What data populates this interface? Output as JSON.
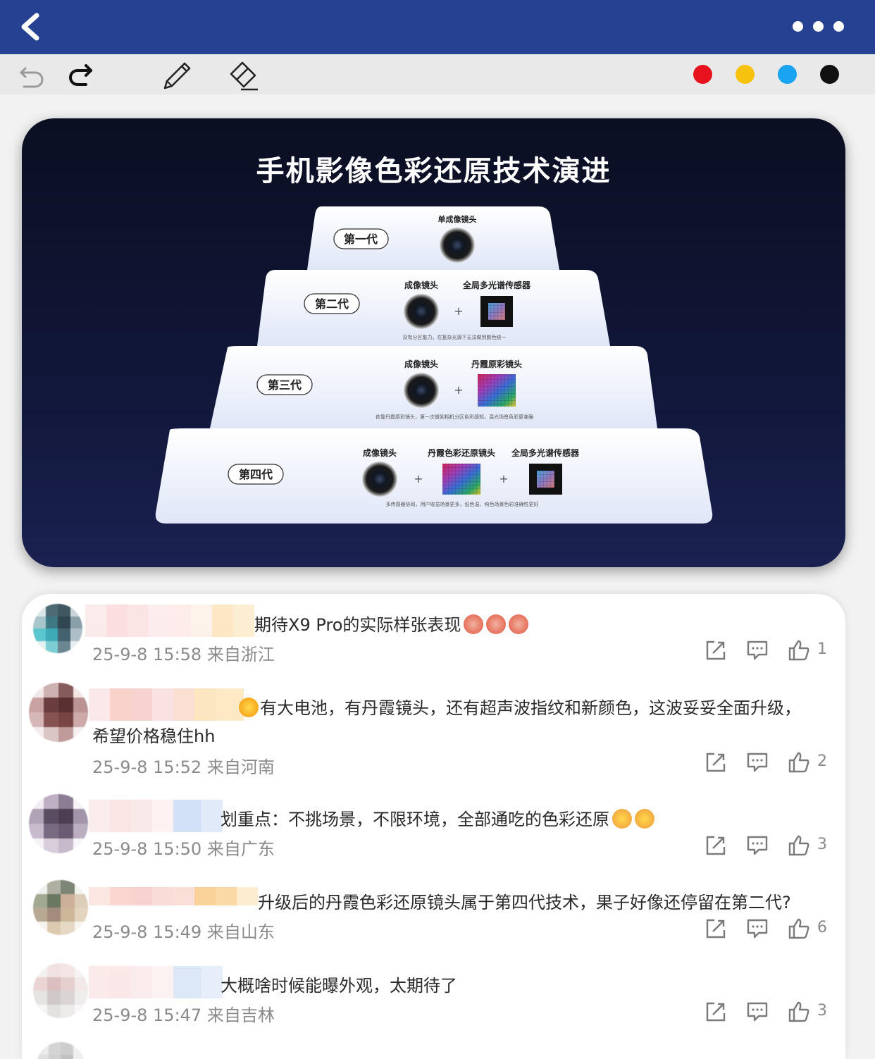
{
  "toolbar": {
    "colors": [
      "#e8121e",
      "#f7c20d",
      "#1aa3f0",
      "#111111"
    ]
  },
  "slide": {
    "title": "手机影像色彩还原技术演进",
    "tiers": [
      {
        "label": "第一代",
        "items": [
          "单成像镜头"
        ],
        "caption": ""
      },
      {
        "label": "第二代",
        "items": [
          "成像镜头",
          "全局多光谱传感器"
        ],
        "caption": "没有分区能力，在复杂光源下无法做到颜色统一"
      },
      {
        "label": "第三代",
        "items": [
          "成像镜头",
          "丹霞原彩镜头"
        ],
        "caption": "依靠丹霞原彩镜头，第一次做到相机分区色彩感知，混光场景色彩更准确"
      },
      {
        "label": "第四代",
        "items": [
          "成像镜头",
          "丹霞色彩还原镜头",
          "全局多光谱传感器"
        ],
        "caption": "多传感器协同，用户收益场景更多，低色温、纯色场景色彩准确性更好"
      }
    ],
    "plus": "+"
  },
  "comments": [
    {
      "text": "期待X9 Pro的实际样张表现",
      "time": "25-9-8 15:58",
      "location": "来自浙江",
      "likes": "1"
    },
    {
      "text": "有大电池，有丹霞镜头，还有超声波指纹和新颜色，这波妥妥全面升级，",
      "text2": "希望价格稳住hh",
      "time": "25-9-8 15:52",
      "location": "来自河南",
      "likes": "2"
    },
    {
      "text": "划重点：不挑场景，不限环境，全部通吃的色彩还原",
      "time": "25-9-8 15:50",
      "location": "来自广东",
      "likes": "3"
    },
    {
      "text": "升级后的丹霞色彩还原镜头属于第四代技术，果子好像还停留在第二代?",
      "time": "25-9-8 15:49",
      "location": "来自山东",
      "likes": "6"
    },
    {
      "text": "大概啥时候能曝外观，太期待了",
      "time": "25-9-8 15:47",
      "location": "来自吉林",
      "likes": "3"
    }
  ]
}
